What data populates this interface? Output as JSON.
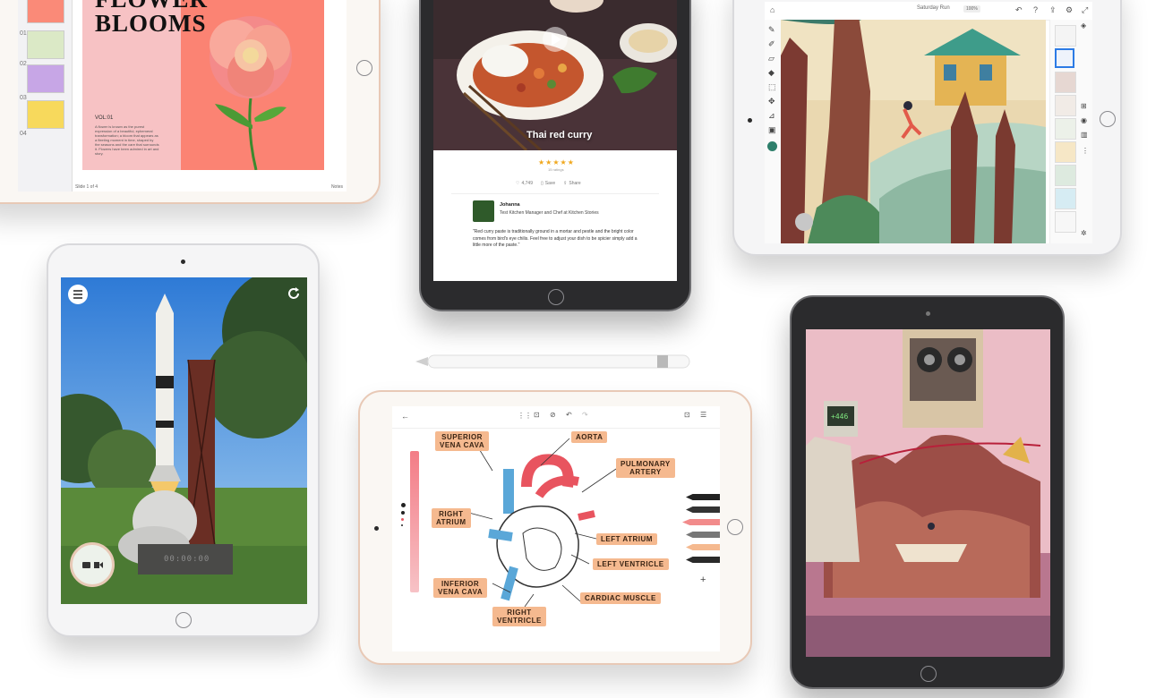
{
  "keynote": {
    "title": "FLOWER\nBLOOMS",
    "volume": "VOL:01",
    "body": "A flower is known as the purest expression of a beautiful, ephemeral transformation; a bloom that appears as a fleeting moment in time, shaped by the seasons and the care that surrounds it. Flowers have been admired in art and story.",
    "slide_numbers": [
      "01",
      "02",
      "03",
      "04"
    ],
    "footer": "Slide 1 of 4",
    "notes_label": "Notes"
  },
  "recipe": {
    "title": "Thai red curry",
    "stars": "★★★★★",
    "rating_text": "15 ratings",
    "likes": "4,749",
    "save_label": "Save",
    "share_label": "Share",
    "author": "Johanna",
    "author_role": "Test Kitchen Manager and Chef at Kitchen Stories",
    "quote": "\"Red curry paste is traditionally ground in a mortar and pestle and the bright color comes from bird's eye chilis. Feel free to adjust your dish to be spicier simply add a little more of the paste.\""
  },
  "frosco": {
    "title": "Saturday Run",
    "zoom": "100%"
  },
  "ar_app": {
    "timer": "00:00:00"
  },
  "anatomy": {
    "labels": {
      "superior_vena_cava": "SUPERIOR\nVENA CAVA",
      "aorta": "AORTA",
      "pulmonary_artery": "PULMONARY\nARTERY",
      "right_atrium": "RIGHT\nATRIUM",
      "left_atrium": "LEFT ATRIUM",
      "left_ventricle": "LEFT VENTRICLE",
      "inferior_vena_cava": "INFERIOR\nVENA CAVA",
      "right_ventricle": "RIGHT\nVENTRICLE",
      "cardiac_muscle": "CARDIAC MUSCLE"
    }
  },
  "game": {
    "display": "+446"
  },
  "colors": {
    "keynote_bg_pink": "#f7c2c4",
    "keynote_coral": "#fb8373",
    "recipe_dark": "#3a2b2e",
    "label_peach": "#f5b98f",
    "heart_red": "#e8545f",
    "heart_blue": "#5aa7d8",
    "game_pink": "#d98aa0"
  }
}
